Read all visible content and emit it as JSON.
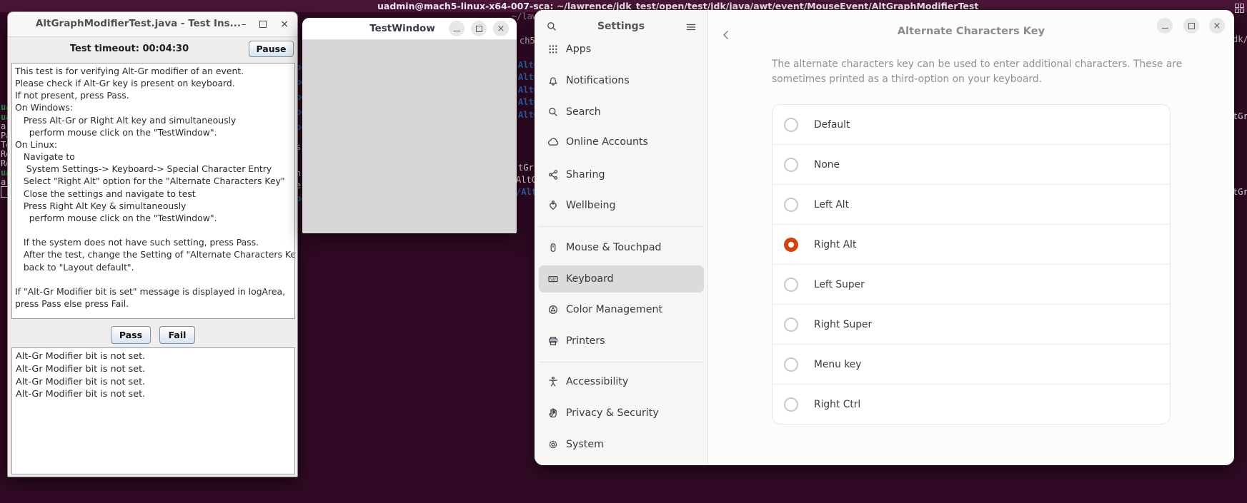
{
  "terminal": {
    "title": "uadmin@mach5-linux-x64-007-sca: ~/lawrence/jdk_test/open/test/jdk/java/awt/event/MouseEvent/AltGraphModifierTest",
    "subtitle_fragment": "~/law",
    "mach_fragment": "ch5",
    "left_fragments": [
      "ua",
      "ua",
      "a",
      "Pa",
      "Te",
      "Re",
      "Re",
      "ua",
      "a"
    ],
    "gap_fragments_a": [
      "po",
      "po",
      "po",
      "po",
      "po",
      "s",
      "n",
      "e",
      "po"
    ],
    "gap_fragments_b": [
      "AltG",
      "AltG",
      "AltG",
      "AltG",
      "AltG",
      "tGr",
      "AltC",
      "/Alt"
    ],
    "right_fragments": [
      "dk/j",
      "tGr",
      "tGr"
    ]
  },
  "test_window": {
    "title": "AltGraphModifierTest.java - Test Ins...",
    "timeout_label": "Test timeout: 00:04:30",
    "pause_label": "Pause",
    "instructions": "This test is for verifying Alt-Gr modifier of an event.\nPlease check if Alt-Gr key is present on keyboard.\nIf not present, press Pass.\nOn Windows:\n   Press Alt-Gr or Right Alt key and simultaneously\n     perform mouse click on the \"TestWindow\".\nOn Linux:\n   Navigate to\n    System Settings-> Keyboard-> Special Character Entry\n   Select \"Right Alt\" option for the \"Alternate Characters Key\"\n   Close the settings and navigate to test\n   Press Right Alt Key & simultaneously\n     perform mouse click on the \"TestWindow\".\n\n   If the system does not have such setting, press Pass.\n   After the test, change the Setting of \"Alternate Characters Key\"\n   back to \"Layout default\".\n\nIf \"Alt-Gr Modifier bit is set\" message is displayed in logArea,\npress Pass else press Fail.",
    "pass_label": "Pass",
    "fail_label": "Fail",
    "log_lines": [
      "Alt-Gr Modifier bit is not set.",
      "Alt-Gr Modifier bit is not set.",
      "Alt-Gr Modifier bit is not set.",
      "Alt-Gr Modifier bit is not set."
    ]
  },
  "popup_window": {
    "title": "TestWindow"
  },
  "settings_window": {
    "sidebar_title": "Settings",
    "sidebar_items": [
      {
        "label": "Apps"
      },
      {
        "label": "Notifications"
      },
      {
        "label": "Search"
      },
      {
        "label": "Online Accounts"
      },
      {
        "label": "Sharing"
      },
      {
        "label": "Wellbeing"
      },
      {
        "label": "Mouse & Touchpad"
      },
      {
        "label": "Keyboard",
        "selected": true
      },
      {
        "label": "Color Management"
      },
      {
        "label": "Printers"
      },
      {
        "label": "Accessibility"
      },
      {
        "label": "Privacy & Security"
      },
      {
        "label": "System"
      }
    ],
    "panel": {
      "title": "Alternate Characters Key",
      "description": "The alternate characters key can be used to enter additional characters. These are sometimes printed as a third-option on your keyboard.",
      "options": [
        "Default",
        "None",
        "Left Alt",
        "Right Alt",
        "Left Super",
        "Right Super",
        "Menu key",
        "Right Ctrl"
      ],
      "selected_option": "Right Alt",
      "accent_color": "#d2450c"
    }
  }
}
